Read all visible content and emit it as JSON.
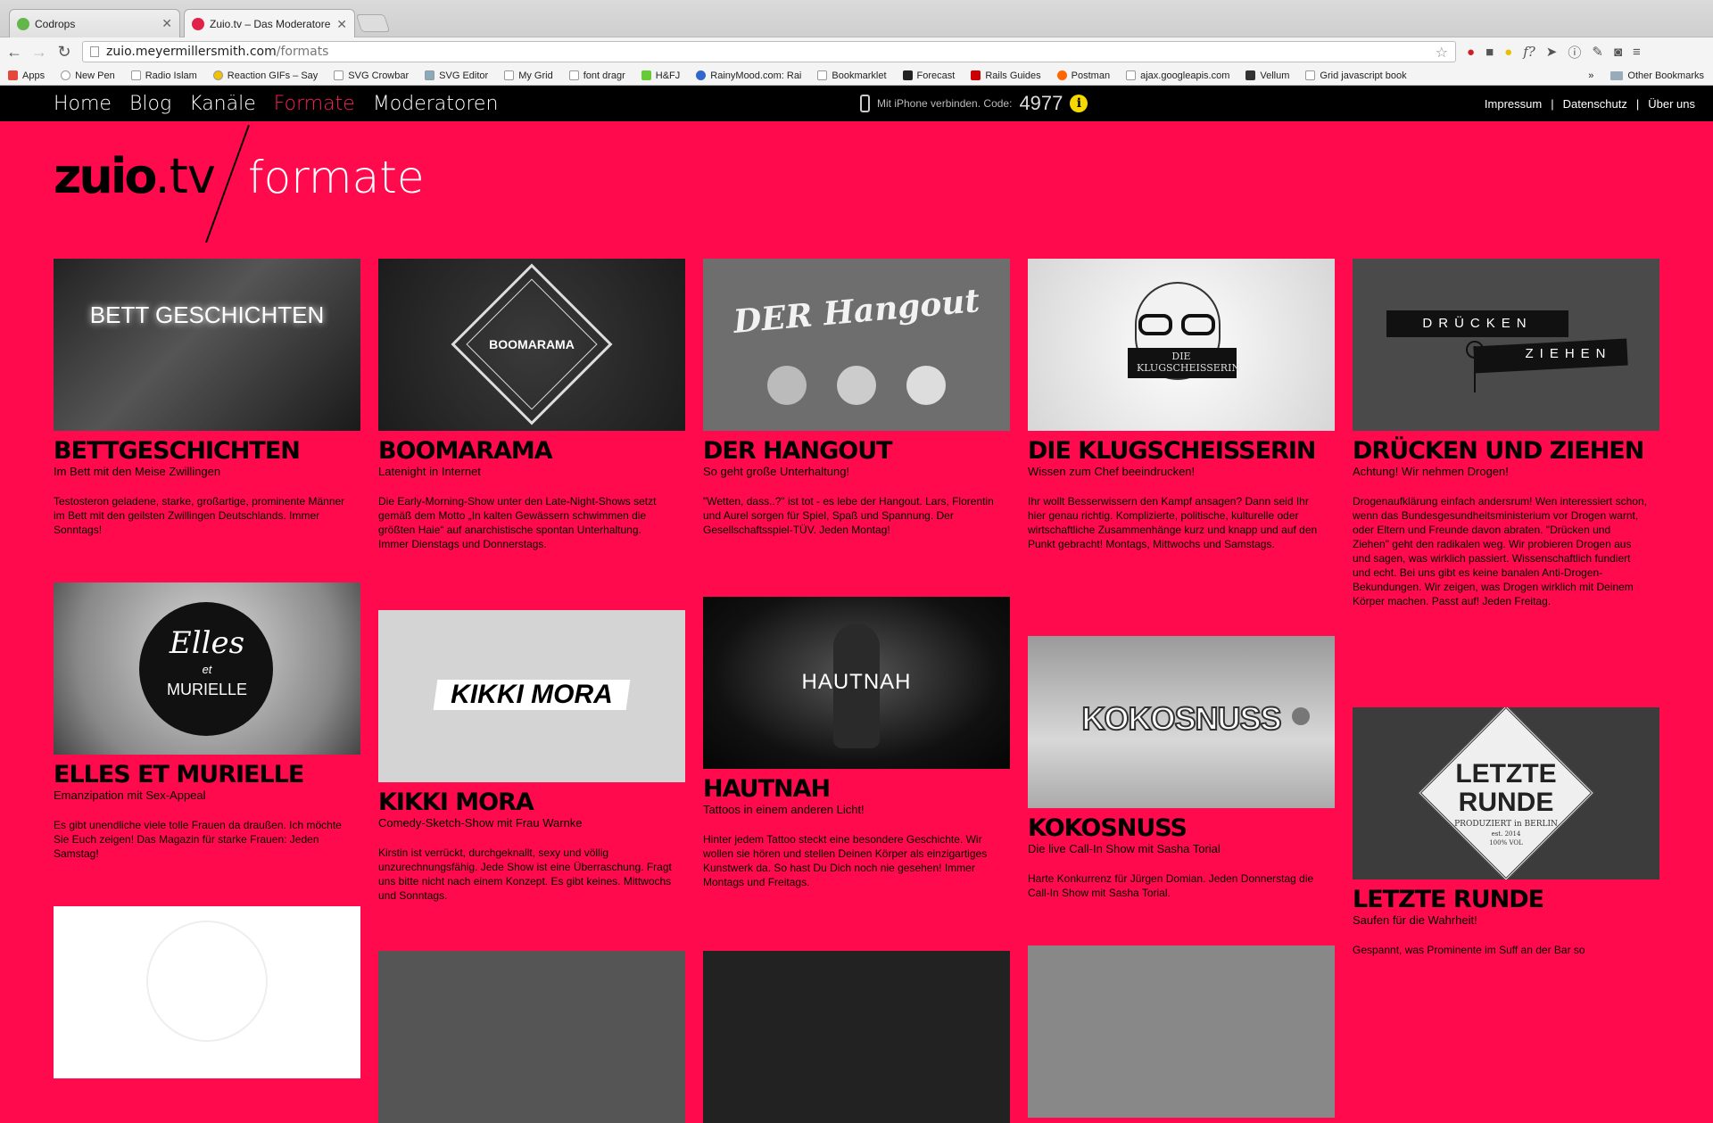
{
  "browser": {
    "tabs": [
      {
        "title": "Codrops",
        "favicon_color": "#64b64a"
      },
      {
        "title": "Zuio.tv – Das Moderatoren",
        "favicon_color": "#e0224b"
      }
    ],
    "url_host": "zuio.meyermillersmith.com",
    "url_path": "/formats",
    "bookmarks": [
      {
        "label": "Apps",
        "icon": "apps-grid-icon"
      },
      {
        "label": "New Pen",
        "icon": "codepen-icon"
      },
      {
        "label": "Radio Islam",
        "icon": "page-icon"
      },
      {
        "label": "Reaction GIFs – Say",
        "icon": "smiley-icon"
      },
      {
        "label": "SVG Crowbar",
        "icon": "page-icon"
      },
      {
        "label": "SVG Editor",
        "icon": "svg-icon"
      },
      {
        "label": "My Grid",
        "icon": "page-icon"
      },
      {
        "label": "font dragr",
        "icon": "page-icon"
      },
      {
        "label": "H&FJ",
        "icon": "hfj-icon"
      },
      {
        "label": "RainyMood.com: Rai",
        "icon": "raindrop-icon"
      },
      {
        "label": "Bookmarklet",
        "icon": "page-icon"
      },
      {
        "label": "Forecast",
        "icon": "forecast-icon"
      },
      {
        "label": "Rails Guides",
        "icon": "rails-icon"
      },
      {
        "label": "Postman",
        "icon": "postman-icon"
      },
      {
        "label": "ajax.googleapis.com",
        "icon": "page-icon"
      },
      {
        "label": "Vellum",
        "icon": "vellum-icon"
      },
      {
        "label": "Grid javascript book",
        "icon": "page-icon"
      }
    ],
    "overflow": "»",
    "other_bookmarks": "Other Bookmarks"
  },
  "site": {
    "nav": [
      {
        "label": "Home",
        "current": false
      },
      {
        "label": "Blog",
        "current": false
      },
      {
        "label": "Kanäle",
        "current": false
      },
      {
        "label": "Formate",
        "current": true
      },
      {
        "label": "Moderatoren",
        "current": false
      }
    ],
    "iphone_text": "Mit iPhone verbinden. Code:",
    "iphone_code": "4977",
    "legal": [
      "Impressum",
      "Datenschutz",
      "Über uns"
    ],
    "logo_main": "zuio",
    "logo_tld": ".tv",
    "section_title": "formate",
    "accent": "#ff0a4d"
  },
  "cards": [
    {
      "title": "BETTGESCHICHTEN",
      "subtitle": "Im Bett mit den Meise Zwillingen",
      "description": "Testosteron geladene, starke, großartige, prominente Männer im Bett mit den geilsten Zwillingen Deutschlands. Immer Sonntags!",
      "image_text": "BETT GESCHICHTEN"
    },
    {
      "title": "BOOMARAMA",
      "subtitle": "Latenight in Internet",
      "description": "Die Early-Morning-Show unter den Late-Night-Shows setzt gemäß dem Motto „In kalten Gewässern schwimmen die größten Haie“ auf anarchistische spontan Unterhaltung. Immer Dienstags und Donnerstags.",
      "image_text": "BOOMARAMA"
    },
    {
      "title": "DER HANGOUT",
      "subtitle": "So geht große Unterhaltung!",
      "description": "\"Wetten, dass..?\" ist tot - es lebe der Hangout. Lars, Florentin und Aurel sorgen für Spiel, Spaß und Spannung. Der Gesellschaftsspiel-TÜV. Jeden Montag!",
      "image_text": "DER Hangout"
    },
    {
      "title": "DIE KLUGSCHEISSERIN",
      "subtitle": "Wissen zum Chef beeindrucken!",
      "description": "Ihr wollt Besserwissern den Kampf ansagen? Dann seid Ihr hier genau richtig. Komplizierte, politische, kulturelle oder wirtschaftliche Zusammenhänge kurz und knapp und auf den Punkt gebracht! Montags, Mittwochs und Samstags.",
      "image_text": "DIE KLUGSCHEISSERIN"
    },
    {
      "title": "DRÜCKEN UND ZIEHEN",
      "subtitle": "Achtung! Wir nehmen Drogen!",
      "description": "Drogenaufklärung einfach andersrum! Wen interessiert schon, wenn das Bundesgesundheitsministerium vor Drogen warnt, oder Eltern und Freunde davon abraten. \"Drücken und Ziehen\" geht den radikalen weg. Wir probieren Drogen aus und sagen, was wirklich passiert. Wissenschaftlich fundiert und echt. Bei uns gibt es keine banalen Anti-Drogen-Bekundungen. Wir zeigen, was Drogen wirklich mit Deinem Körper machen. Passt auf! Jeden Freitag.",
      "image_text_1": "DRÜCKEN",
      "image_text_2": "ZIEHEN"
    },
    {
      "title": "ELLES ET MURIELLE",
      "subtitle": "Emanzipation mit Sex-Appeal",
      "description": "Es gibt unendliche viele tolle Frauen da draußen. Ich möchte Sie Euch zeigen! Das Magazin für starke Frauen: Jeden Samstag!",
      "image_text_1": "Elles",
      "image_text_2": "et",
      "image_text_3": "MURIELLE"
    },
    {
      "title": "KIKKI MORA",
      "subtitle": "Comedy-Sketch-Show mit Frau Warnke",
      "description": "Kirstin ist verrückt, durchgeknallt, sexy und völlig unzurechnungsfähig. Jede Show ist eine Überraschung. Fragt uns bitte nicht nach einem Konzept. Es gibt keines. Mittwochs und Sonntags.",
      "image_text": "KIKKI MORA"
    },
    {
      "title": "HAUTNAH",
      "subtitle": "Tattoos in einem anderen Licht!",
      "description": "Hinter jedem Tattoo steckt eine besondere Geschichte. Wir wollen sie hören und stellen Deinen Körper als einzigartiges Kunstwerk da. So hast Du Dich noch nie gesehen! Immer Montags und Freitags.",
      "image_text": "HAUTNAH"
    },
    {
      "title": "KOKOSNUSS",
      "subtitle": "Die live Call-In Show mit Sasha Torial",
      "description": "Harte Konkurrenz für Jürgen Domian. Jeden Donnerstag die Call-In Show mit Sasha Torial.",
      "image_text": "KOKOSNUSS"
    },
    {
      "title": "LETZTE RUNDE",
      "subtitle": "Saufen für die Wahrheit!",
      "description": "Gespannt, was Prominente im Suff an der Bar so",
      "image_text_1": "LETZTE",
      "image_text_2": "RUNDE",
      "image_text_3": "PRODUZIERT in BERLIN",
      "image_text_4": "est. 2014",
      "image_text_5": "100% VOL"
    }
  ]
}
